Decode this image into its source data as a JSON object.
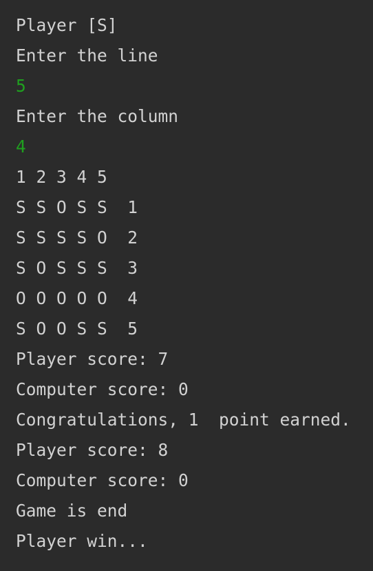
{
  "console": {
    "colors": {
      "background": "#2b2b2b",
      "output_text": "#d2d2d2",
      "user_input": "#1fa01f"
    },
    "lines": [
      {
        "text": "Player [S]",
        "kind": "output"
      },
      {
        "text": "Enter the line",
        "kind": "output"
      },
      {
        "text": "5",
        "kind": "input"
      },
      {
        "text": "Enter the column",
        "kind": "output"
      },
      {
        "text": "4",
        "kind": "input"
      },
      {
        "text": "1 2 3 4 5",
        "kind": "output"
      },
      {
        "text": "S S O S S  1",
        "kind": "output"
      },
      {
        "text": "S S S S O  2",
        "kind": "output"
      },
      {
        "text": "S O S S S  3",
        "kind": "output"
      },
      {
        "text": "O O O O O  4",
        "kind": "output"
      },
      {
        "text": "S O O S S  5",
        "kind": "output"
      },
      {
        "text": "Player score: 7",
        "kind": "output"
      },
      {
        "text": "Computer score: 0",
        "kind": "output"
      },
      {
        "text": "Congratulations, 1  point earned.",
        "kind": "output"
      },
      {
        "text": "Player score: 8",
        "kind": "output"
      },
      {
        "text": "Computer score: 0",
        "kind": "output"
      },
      {
        "text": "Game is end",
        "kind": "output"
      },
      {
        "text": "Player win...",
        "kind": "output"
      }
    ]
  }
}
